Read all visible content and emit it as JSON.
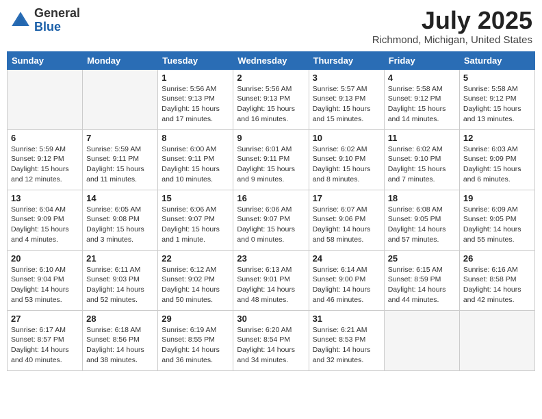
{
  "logo": {
    "general": "General",
    "blue": "Blue"
  },
  "header": {
    "month": "July 2025",
    "location": "Richmond, Michigan, United States"
  },
  "weekdays": [
    "Sunday",
    "Monday",
    "Tuesday",
    "Wednesday",
    "Thursday",
    "Friday",
    "Saturday"
  ],
  "weeks": [
    [
      {
        "day": "",
        "info": ""
      },
      {
        "day": "",
        "info": ""
      },
      {
        "day": "1",
        "info": "Sunrise: 5:56 AM\nSunset: 9:13 PM\nDaylight: 15 hours\nand 17 minutes."
      },
      {
        "day": "2",
        "info": "Sunrise: 5:56 AM\nSunset: 9:13 PM\nDaylight: 15 hours\nand 16 minutes."
      },
      {
        "day": "3",
        "info": "Sunrise: 5:57 AM\nSunset: 9:13 PM\nDaylight: 15 hours\nand 15 minutes."
      },
      {
        "day": "4",
        "info": "Sunrise: 5:58 AM\nSunset: 9:12 PM\nDaylight: 15 hours\nand 14 minutes."
      },
      {
        "day": "5",
        "info": "Sunrise: 5:58 AM\nSunset: 9:12 PM\nDaylight: 15 hours\nand 13 minutes."
      }
    ],
    [
      {
        "day": "6",
        "info": "Sunrise: 5:59 AM\nSunset: 9:12 PM\nDaylight: 15 hours\nand 12 minutes."
      },
      {
        "day": "7",
        "info": "Sunrise: 5:59 AM\nSunset: 9:11 PM\nDaylight: 15 hours\nand 11 minutes."
      },
      {
        "day": "8",
        "info": "Sunrise: 6:00 AM\nSunset: 9:11 PM\nDaylight: 15 hours\nand 10 minutes."
      },
      {
        "day": "9",
        "info": "Sunrise: 6:01 AM\nSunset: 9:11 PM\nDaylight: 15 hours\nand 9 minutes."
      },
      {
        "day": "10",
        "info": "Sunrise: 6:02 AM\nSunset: 9:10 PM\nDaylight: 15 hours\nand 8 minutes."
      },
      {
        "day": "11",
        "info": "Sunrise: 6:02 AM\nSunset: 9:10 PM\nDaylight: 15 hours\nand 7 minutes."
      },
      {
        "day": "12",
        "info": "Sunrise: 6:03 AM\nSunset: 9:09 PM\nDaylight: 15 hours\nand 6 minutes."
      }
    ],
    [
      {
        "day": "13",
        "info": "Sunrise: 6:04 AM\nSunset: 9:09 PM\nDaylight: 15 hours\nand 4 minutes."
      },
      {
        "day": "14",
        "info": "Sunrise: 6:05 AM\nSunset: 9:08 PM\nDaylight: 15 hours\nand 3 minutes."
      },
      {
        "day": "15",
        "info": "Sunrise: 6:06 AM\nSunset: 9:07 PM\nDaylight: 15 hours\nand 1 minute."
      },
      {
        "day": "16",
        "info": "Sunrise: 6:06 AM\nSunset: 9:07 PM\nDaylight: 15 hours\nand 0 minutes."
      },
      {
        "day": "17",
        "info": "Sunrise: 6:07 AM\nSunset: 9:06 PM\nDaylight: 14 hours\nand 58 minutes."
      },
      {
        "day": "18",
        "info": "Sunrise: 6:08 AM\nSunset: 9:05 PM\nDaylight: 14 hours\nand 57 minutes."
      },
      {
        "day": "19",
        "info": "Sunrise: 6:09 AM\nSunset: 9:05 PM\nDaylight: 14 hours\nand 55 minutes."
      }
    ],
    [
      {
        "day": "20",
        "info": "Sunrise: 6:10 AM\nSunset: 9:04 PM\nDaylight: 14 hours\nand 53 minutes."
      },
      {
        "day": "21",
        "info": "Sunrise: 6:11 AM\nSunset: 9:03 PM\nDaylight: 14 hours\nand 52 minutes."
      },
      {
        "day": "22",
        "info": "Sunrise: 6:12 AM\nSunset: 9:02 PM\nDaylight: 14 hours\nand 50 minutes."
      },
      {
        "day": "23",
        "info": "Sunrise: 6:13 AM\nSunset: 9:01 PM\nDaylight: 14 hours\nand 48 minutes."
      },
      {
        "day": "24",
        "info": "Sunrise: 6:14 AM\nSunset: 9:00 PM\nDaylight: 14 hours\nand 46 minutes."
      },
      {
        "day": "25",
        "info": "Sunrise: 6:15 AM\nSunset: 8:59 PM\nDaylight: 14 hours\nand 44 minutes."
      },
      {
        "day": "26",
        "info": "Sunrise: 6:16 AM\nSunset: 8:58 PM\nDaylight: 14 hours\nand 42 minutes."
      }
    ],
    [
      {
        "day": "27",
        "info": "Sunrise: 6:17 AM\nSunset: 8:57 PM\nDaylight: 14 hours\nand 40 minutes."
      },
      {
        "day": "28",
        "info": "Sunrise: 6:18 AM\nSunset: 8:56 PM\nDaylight: 14 hours\nand 38 minutes."
      },
      {
        "day": "29",
        "info": "Sunrise: 6:19 AM\nSunset: 8:55 PM\nDaylight: 14 hours\nand 36 minutes."
      },
      {
        "day": "30",
        "info": "Sunrise: 6:20 AM\nSunset: 8:54 PM\nDaylight: 14 hours\nand 34 minutes."
      },
      {
        "day": "31",
        "info": "Sunrise: 6:21 AM\nSunset: 8:53 PM\nDaylight: 14 hours\nand 32 minutes."
      },
      {
        "day": "",
        "info": ""
      },
      {
        "day": "",
        "info": ""
      }
    ]
  ]
}
